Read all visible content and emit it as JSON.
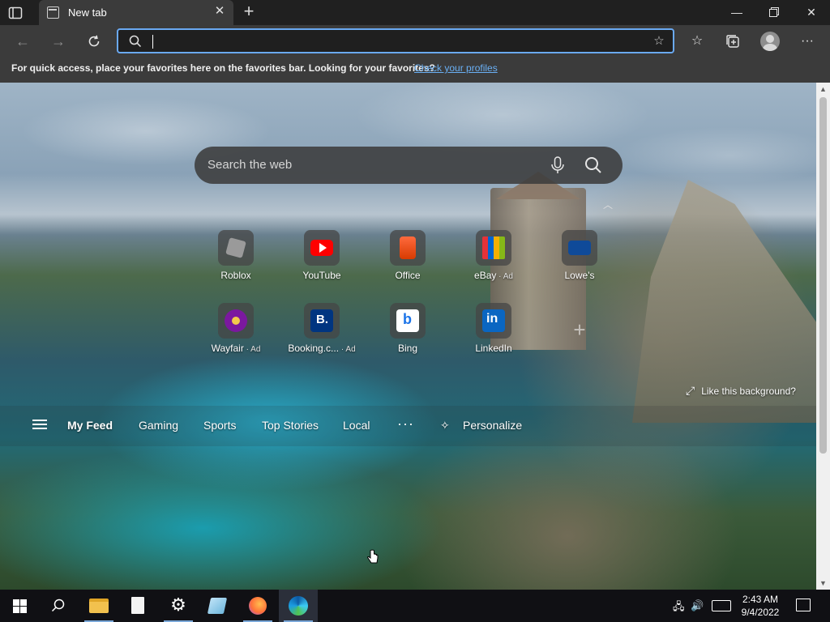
{
  "browser": {
    "tab": {
      "title": "New tab"
    },
    "address_bar": {
      "value": "",
      "placeholder": ""
    },
    "favorites_hint": {
      "message": "For quick access, place your favorites here on the favorites bar. Looking for your favorites?",
      "link": "Check your profiles"
    }
  },
  "newtab": {
    "search": {
      "placeholder": "Search the web"
    },
    "tiles": [
      {
        "label": "Roblox",
        "ad": "",
        "icon": "roblox-icon"
      },
      {
        "label": "YouTube",
        "ad": "",
        "icon": "youtube-icon"
      },
      {
        "label": "Office",
        "ad": "",
        "icon": "office-icon"
      },
      {
        "label": "eBay",
        "ad": " · Ad",
        "icon": "ebay-icon"
      },
      {
        "label": "Lowe's",
        "ad": "",
        "icon": "lowes-icon"
      },
      {
        "label": "Wayfair",
        "ad": " · Ad",
        "icon": "wayfair-icon"
      },
      {
        "label": "Booking.c...",
        "ad": " · Ad",
        "icon": "booking-icon"
      },
      {
        "label": "Bing",
        "ad": "",
        "icon": "bing-icon"
      },
      {
        "label": "LinkedIn",
        "ad": "",
        "icon": "linkedin-icon"
      }
    ],
    "like_background": "Like this background?",
    "feed": {
      "items": [
        "My Feed",
        "Gaming",
        "Sports",
        "Top Stories",
        "Local"
      ],
      "more": "···",
      "personalize": "Personalize"
    }
  },
  "taskbar": {
    "time": "2:43 AM",
    "date": "9/4/2022"
  },
  "colors": {
    "accent": "#6aa9f2",
    "link": "#6ab0f5",
    "chrome_dark": "#202020",
    "chrome_mid": "#3b3b3b"
  }
}
